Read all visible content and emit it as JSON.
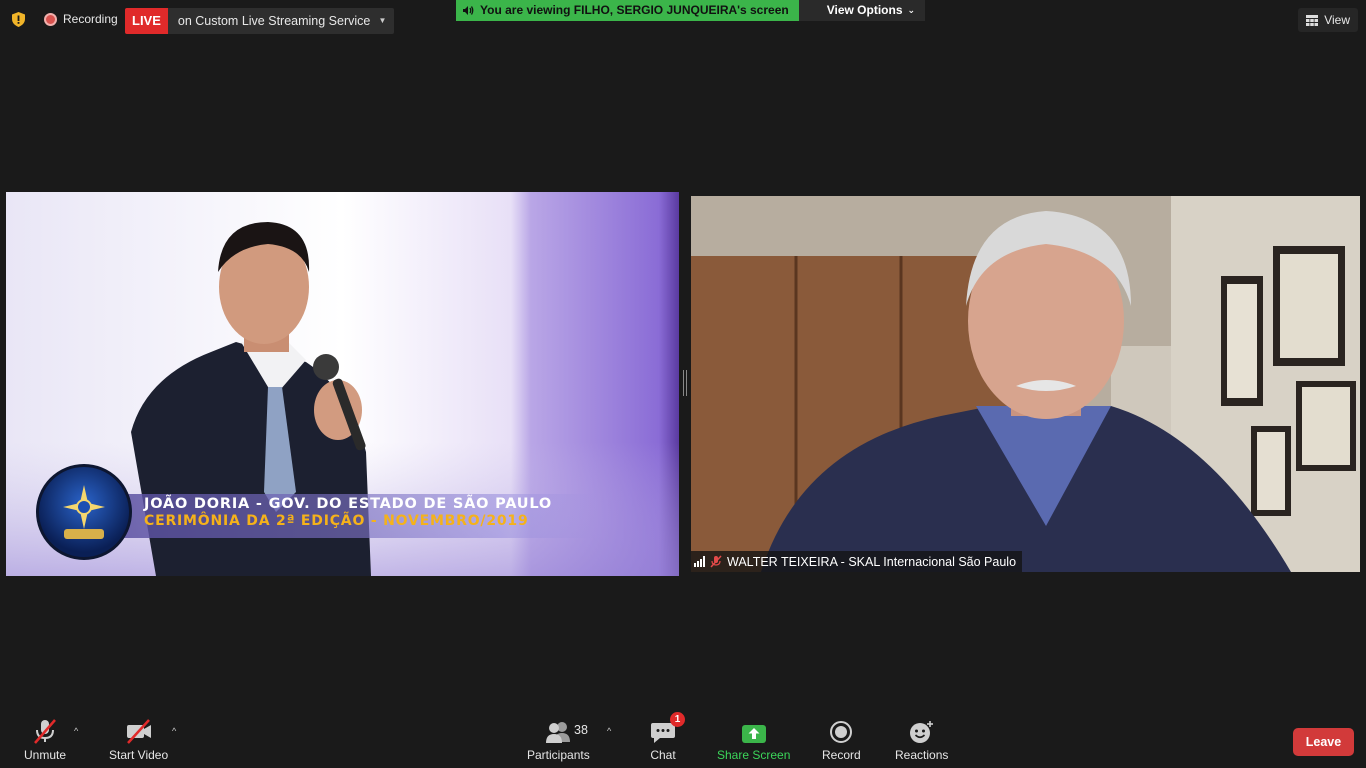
{
  "topbar": {
    "recording_label": "Recording",
    "live_badge": "LIVE",
    "live_service": "on Custom Live Streaming Service",
    "viewing_text": "You are viewing FILHO, SERGIO JUNQUEIRA's screen",
    "view_options_label": "View Options",
    "view_button_label": "View"
  },
  "tiles": {
    "left": {
      "lower_third_line1": "JOÃO DORIA - GOV. DO ESTADO DE SÃO PAULO",
      "lower_third_line2": "CERIMÔNIA DA 2ª EDIÇÃO - NOVEMBRO/2019"
    },
    "right": {
      "name_tag": "WALTER TEIXEIRA - SKAL Internacional São Paulo"
    }
  },
  "toolbar": {
    "unmute_label": "Unmute",
    "start_video_label": "Start Video",
    "participants_label": "Participants",
    "participants_count": "38",
    "chat_label": "Chat",
    "chat_badge": "1",
    "share_screen_label": "Share Screen",
    "record_label": "Record",
    "reactions_label": "Reactions",
    "leave_label": "Leave"
  },
  "colors": {
    "background": "#1a1a1a",
    "live_red": "#e02a2a",
    "share_green": "#3bb54a",
    "leave_red": "#d23a3a",
    "lower_third_gold": "#f5b21a"
  }
}
